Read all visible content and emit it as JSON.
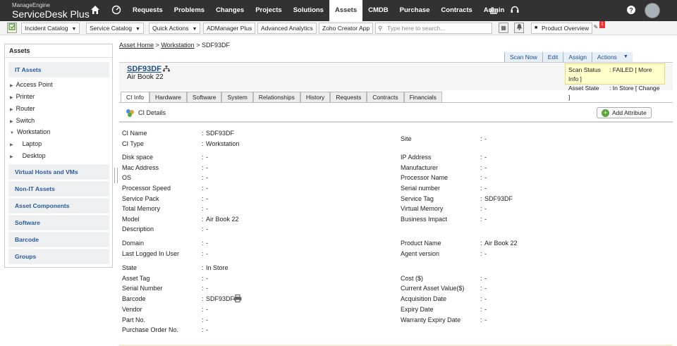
{
  "brand": {
    "vendor": "ManageEngine",
    "product": "ServiceDesk Plus"
  },
  "nav": {
    "items": [
      "Requests",
      "Problems",
      "Changes",
      "Projects",
      "Solutions",
      "Assets",
      "CMDB",
      "Purchase",
      "Contracts",
      "Admin"
    ],
    "active": "Assets"
  },
  "toolbar": {
    "incident_catalog": "Incident Catalog",
    "service_catalog": "Service Catalog",
    "quick_actions": "Quick Actions",
    "admanager": "ADManager Plus",
    "advanced_analytics": "Advanced Analytics",
    "zoho_creator": "Zoho Creator App",
    "search_placeholder": "Type here to search...",
    "product_overview": "Product Overview",
    "badge_count": "1"
  },
  "sidebar": {
    "title": "Assets",
    "it_assets": "IT Assets",
    "tree": [
      "Access Point",
      "Printer",
      "Router",
      "Switch",
      "Workstation",
      "Laptop",
      "Desktop"
    ],
    "sections": [
      "Virtual Hosts and VMs",
      "Non-IT Assets",
      "Asset Components",
      "Software",
      "Barcode",
      "Groups"
    ]
  },
  "breadcrumb": {
    "home": "Asset Home",
    "sep": ">",
    "category": "Workstation",
    "current": "SDF93DF"
  },
  "actions": {
    "scan_now": "Scan Now",
    "edit": "Edit",
    "assign": "Assign",
    "actions": "Actions"
  },
  "ci": {
    "name": "SDF93DF",
    "model": "Air Book 22"
  },
  "scan": {
    "status_label": "Scan Status",
    "status_value": ": FAILED",
    "more_info": "[ More Info ]",
    "state_label": "Asset State",
    "state_value": ": In Store",
    "change": "[ Change ]"
  },
  "tabs": [
    "CI Info",
    "Hardware",
    "Software",
    "System",
    "Relationships",
    "History",
    "Requests",
    "Contracts",
    "Financials"
  ],
  "details": {
    "title": "CI Details",
    "add_attribute": "Add Attribute"
  },
  "left_fields": [
    {
      "label": "CI Name",
      "value": "SDF93DF"
    },
    {
      "label": "CI Type",
      "value": "Workstation"
    },
    {
      "label": "Disk space",
      "value": "-"
    },
    {
      "label": "Mac Address",
      "value": "-"
    },
    {
      "label": "OS",
      "value": "-"
    },
    {
      "label": "Processor Speed",
      "value": "-"
    },
    {
      "label": "Service Pack",
      "value": "-"
    },
    {
      "label": "Total Memory",
      "value": "-"
    },
    {
      "label": "Model",
      "value": "Air Book 22"
    },
    {
      "label": "Description",
      "value": "-"
    },
    {
      "label": "Domain",
      "value": "-"
    },
    {
      "label": "Last Logged In User",
      "value": "-"
    },
    {
      "label": "State",
      "value": "In Store"
    },
    {
      "label": "Asset Tag",
      "value": "-"
    },
    {
      "label": "Serial Number",
      "value": "-"
    },
    {
      "label": "Barcode",
      "value": "SDF93DF"
    },
    {
      "label": "Vendor",
      "value": "-"
    },
    {
      "label": "Part No.",
      "value": "-"
    },
    {
      "label": "Purchase Order No.",
      "value": "-"
    }
  ],
  "right_fields": [
    {
      "label": "Site",
      "value": "-"
    },
    {
      "label": "IP Address",
      "value": "-"
    },
    {
      "label": "Manufacturer",
      "value": "-"
    },
    {
      "label": "Processor Name",
      "value": "-"
    },
    {
      "label": "Serial number",
      "value": "-"
    },
    {
      "label": "Service Tag",
      "value": "SDF93DF"
    },
    {
      "label": "Virtual Memory",
      "value": "-"
    },
    {
      "label": "Business Impact",
      "value": "-"
    },
    {
      "label": "Product Name",
      "value": "Air Book 22"
    },
    {
      "label": "Agent version",
      "value": "-"
    },
    {
      "label": "Cost ($)",
      "value": "-"
    },
    {
      "label": "Current Asset Value($)",
      "value": "-"
    },
    {
      "label": "Acquisition Date",
      "value": "-"
    },
    {
      "label": "Expiry Date",
      "value": "-"
    },
    {
      "label": "Warranty Expiry Date",
      "value": "-"
    }
  ],
  "colon": ":"
}
